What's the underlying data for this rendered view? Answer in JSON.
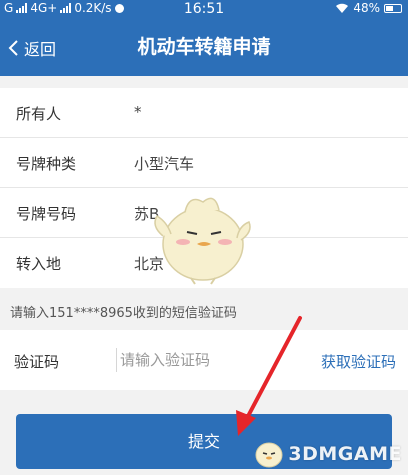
{
  "status_bar": {
    "carrier": "G",
    "network": "4G+",
    "speed": "0.2K/s",
    "time": "16:51",
    "battery": "48%"
  },
  "nav": {
    "back_label": "返回",
    "title": "机动车转籍申请"
  },
  "info": {
    "rows": [
      {
        "label": "所有人",
        "value": "*"
      },
      {
        "label": "号牌种类",
        "value": "小型汽车"
      },
      {
        "label": "号牌号码",
        "value": "苏B"
      },
      {
        "label": "转入地",
        "value": "北京"
      }
    ]
  },
  "sms_hint": "请输入151****8965收到的短信验证码",
  "verification": {
    "label": "验证码",
    "placeholder": "请输入验证码",
    "get_code_label": "获取验证码"
  },
  "submit_label": "提交",
  "watermark": "3DMGAME",
  "colors": {
    "primary": "#2c6fb8",
    "arrow": "#e5252a"
  }
}
